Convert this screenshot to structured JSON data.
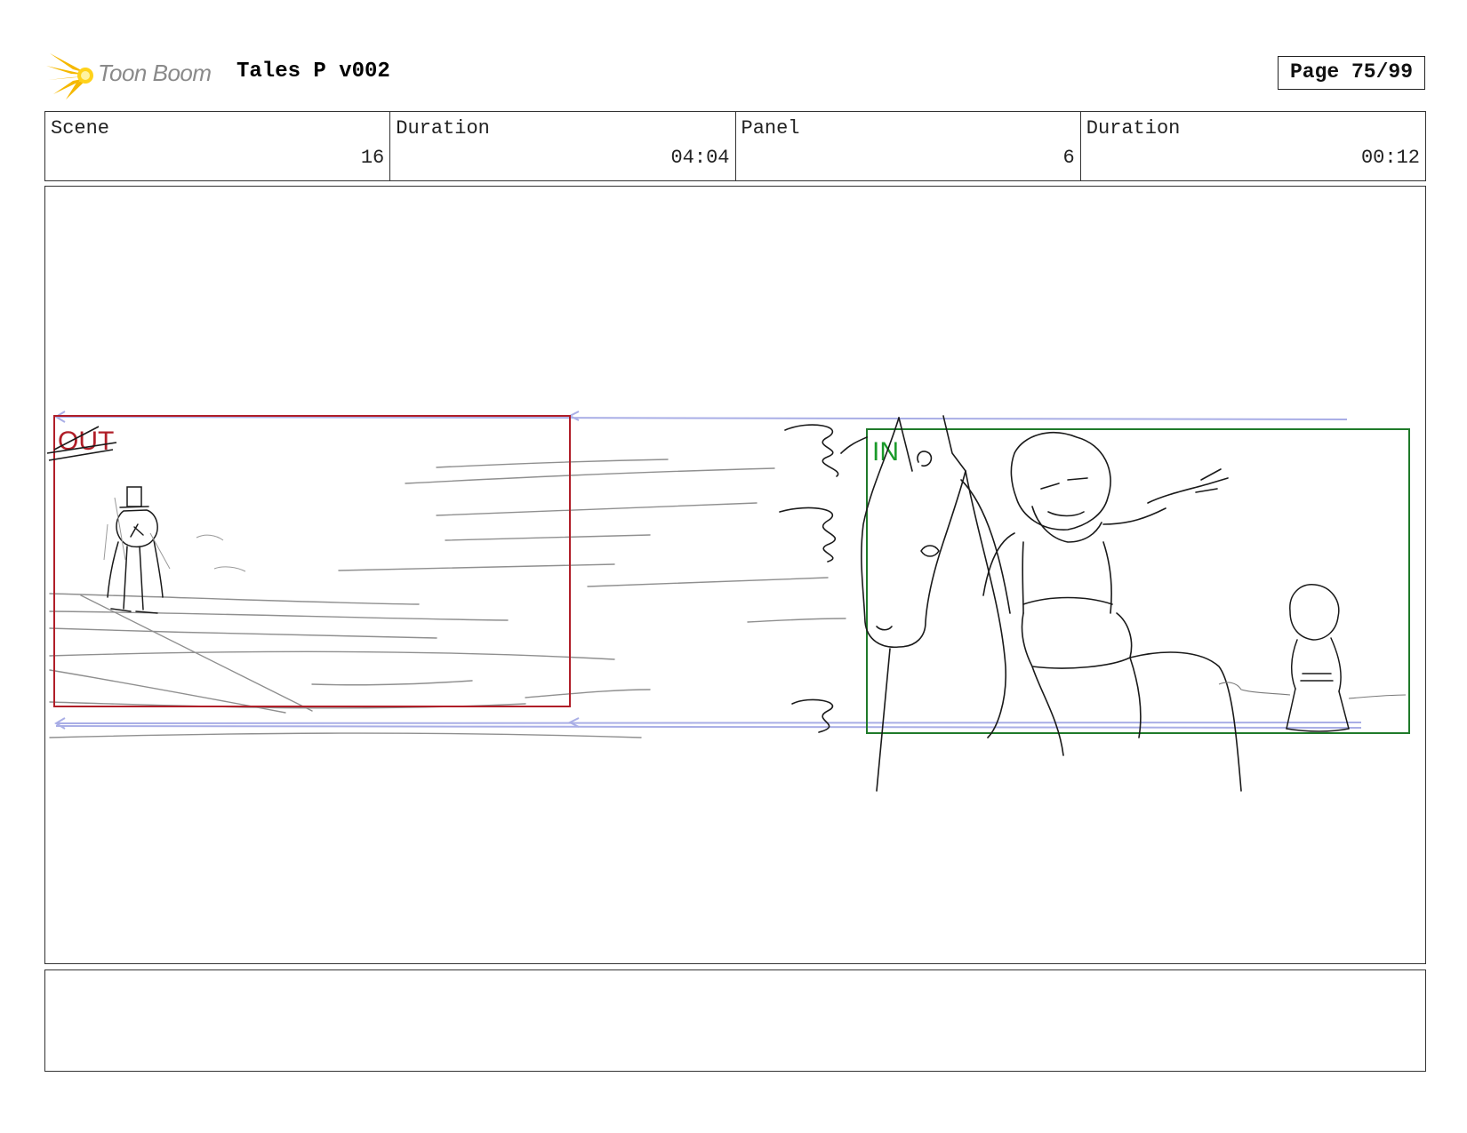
{
  "header": {
    "logo_text": "Toon Boom",
    "project_title": "Tales P v002",
    "page_label": "Page 75/99"
  },
  "info": [
    {
      "label": "Scene",
      "value": "16"
    },
    {
      "label": "Duration",
      "value": "04:04"
    },
    {
      "label": "Panel",
      "value": "6"
    },
    {
      "label": "Duration",
      "value": "00:12"
    }
  ],
  "panel": {
    "out_label": "OUT",
    "in_label": "IN",
    "colors": {
      "out_frame": "#b01e28",
      "in_frame": "#1f7a2a",
      "in_label": "#1a9a2a",
      "camera_path": "#a9aee6",
      "sketch": "#1a1a1a",
      "speed_lines": "#8f8f8f"
    }
  },
  "notes": {
    "text": ""
  }
}
